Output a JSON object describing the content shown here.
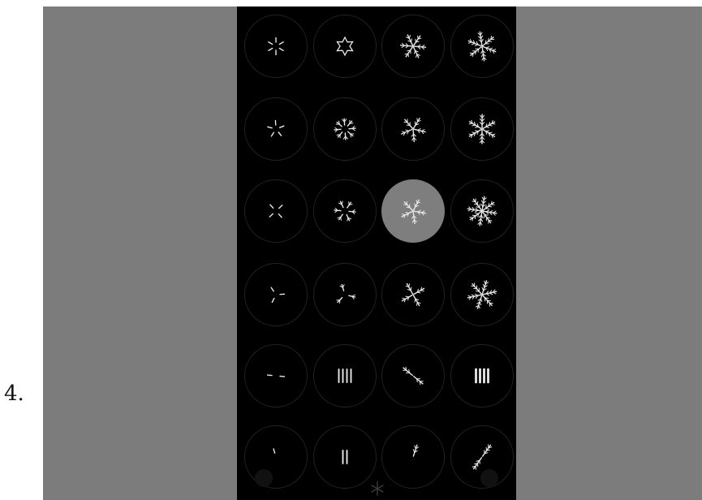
{
  "step_label": "4.",
  "selected_index": 10,
  "grid": {
    "rows": 6,
    "cols": 4,
    "cells": [
      {
        "name": "pattern-1",
        "arms": 6,
        "density": 1
      },
      {
        "name": "pattern-2",
        "arms": 6,
        "density": 2,
        "star": true
      },
      {
        "name": "pattern-3",
        "arms": 6,
        "density": 3
      },
      {
        "name": "pattern-4",
        "arms": 6,
        "density": 4
      },
      {
        "name": "pattern-5",
        "arms": 5,
        "density": 1
      },
      {
        "name": "pattern-6",
        "arms": 8,
        "density": 2
      },
      {
        "name": "pattern-7",
        "arms": 5,
        "density": 3
      },
      {
        "name": "pattern-8",
        "arms": 6,
        "density": 4
      },
      {
        "name": "pattern-9",
        "arms": 4,
        "density": 1
      },
      {
        "name": "pattern-10",
        "arms": 6,
        "density": 2
      },
      {
        "name": "pattern-11",
        "arms": 5,
        "density": 3
      },
      {
        "name": "pattern-12",
        "arms": 8,
        "density": 4
      },
      {
        "name": "pattern-13",
        "arms": 3,
        "density": 1
      },
      {
        "name": "pattern-14",
        "arms": 3,
        "density": 2
      },
      {
        "name": "pattern-15",
        "arms": 4,
        "density": 3
      },
      {
        "name": "pattern-16",
        "arms": 6,
        "density": 4
      },
      {
        "name": "pattern-17",
        "arms": 2,
        "density": 1
      },
      {
        "name": "pattern-18",
        "arms": 4,
        "density": 1,
        "parallel": true
      },
      {
        "name": "pattern-19",
        "arms": 2,
        "density": 3
      },
      {
        "name": "pattern-20",
        "arms": 4,
        "density": 4,
        "parallel": true
      },
      {
        "name": "pattern-21",
        "arms": 1,
        "density": 1
      },
      {
        "name": "pattern-22",
        "arms": 2,
        "density": 1,
        "parallel": true
      },
      {
        "name": "pattern-23",
        "arms": 1,
        "density": 3
      },
      {
        "name": "pattern-24",
        "arms": 2,
        "density": 4
      }
    ]
  },
  "icons": {
    "bottom": "snowflake-icon"
  }
}
